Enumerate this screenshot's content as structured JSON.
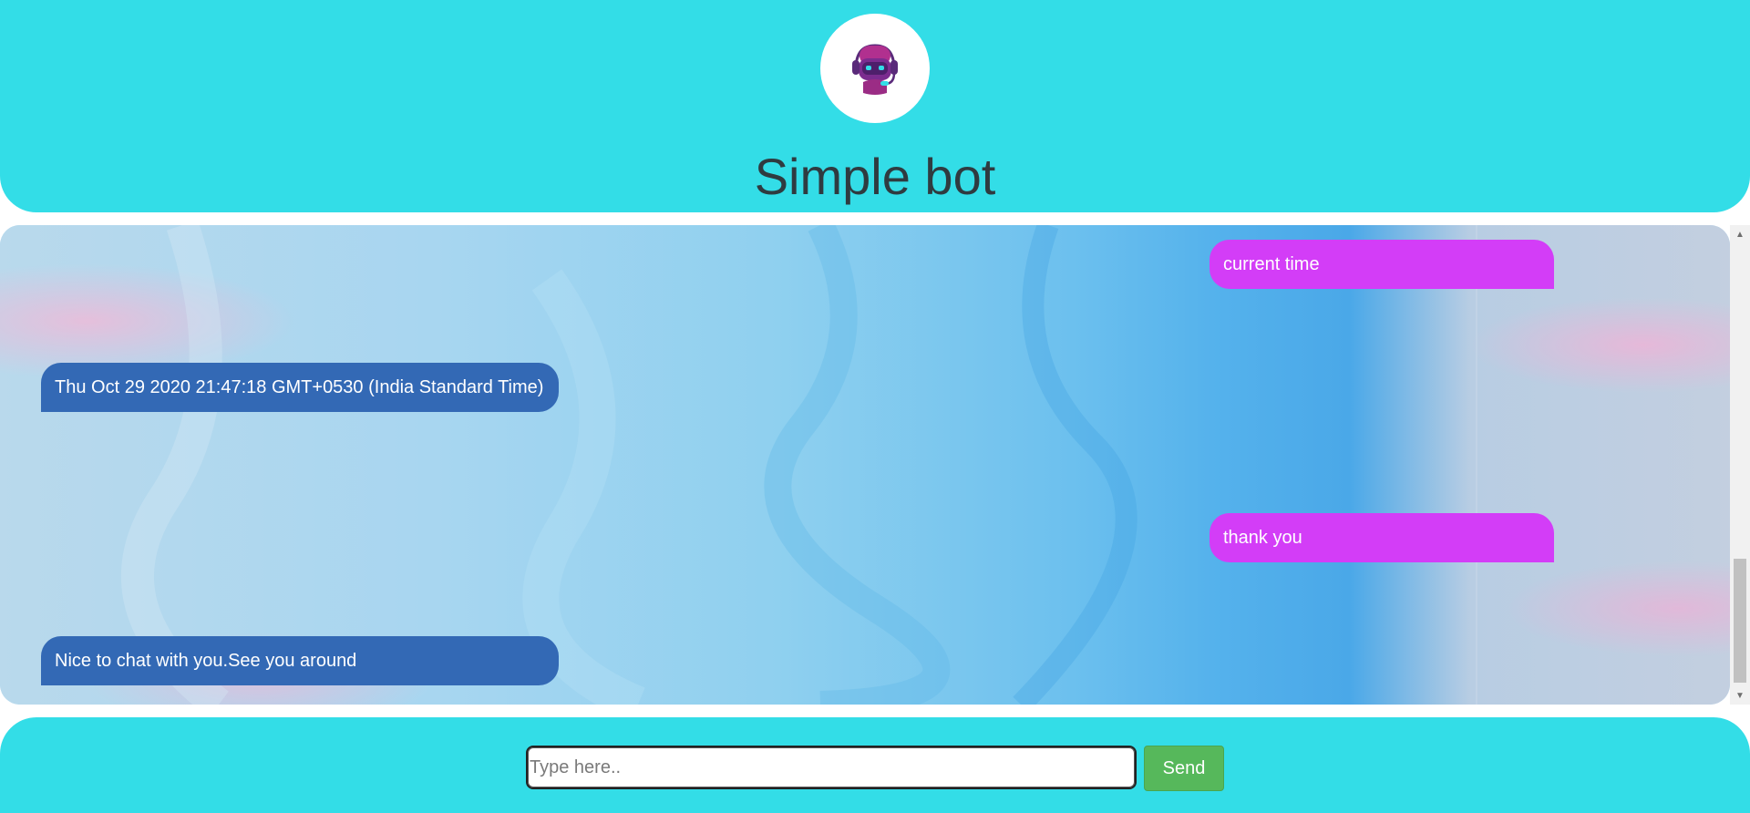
{
  "header": {
    "title": "Simple bot",
    "logo_icon": "robot-headset-icon"
  },
  "messages": [
    {
      "from": "user",
      "text": "current time"
    },
    {
      "from": "bot",
      "text": "Thu Oct 29 2020 21:47:18 GMT+0530 (India Standard Time)"
    },
    {
      "from": "user",
      "text": "thank you"
    },
    {
      "from": "bot",
      "text": "Nice to chat with you.See you around"
    }
  ],
  "composer": {
    "placeholder": "Type here..",
    "value": "",
    "send_label": "Send"
  },
  "colors": {
    "header_bg": "#33dde7",
    "user_bubble": "#d33df7",
    "bot_bubble": "#3369b5",
    "send_button": "#56b85b"
  }
}
